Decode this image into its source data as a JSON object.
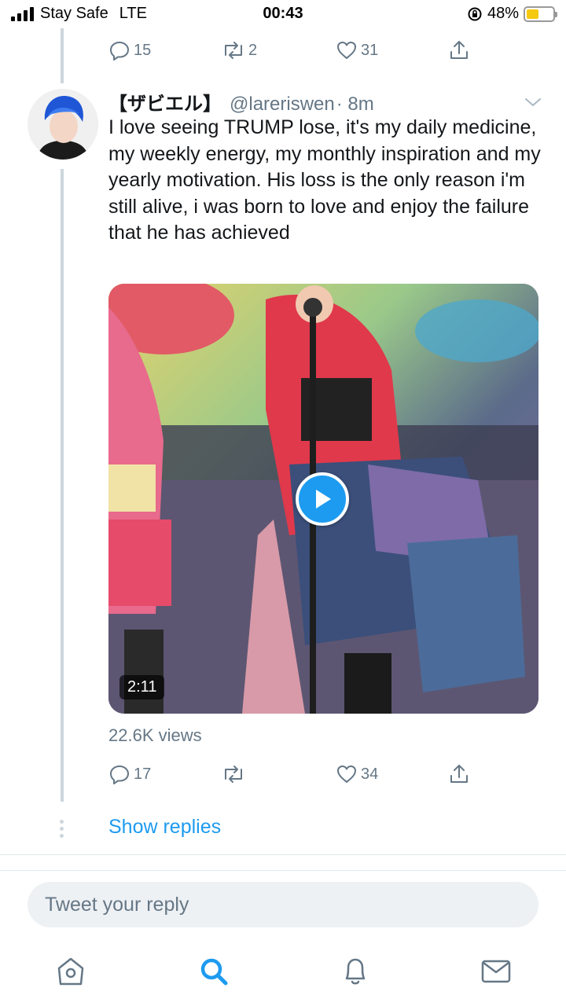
{
  "status_bar": {
    "carrier": "Stay Safe",
    "network": "LTE",
    "time": "00:43",
    "battery_percent": "48%",
    "battery_level": 0.48
  },
  "prev_tweet": {
    "replies": "15",
    "retweets": "2",
    "likes": "31"
  },
  "tweet": {
    "name": "【ザビエル】",
    "handle": "@lareriswen",
    "time": "· 8m",
    "text": "I love seeing TRUMP lose, it's my daily medicine, my weekly energy, my monthly inspiration and my yearly motivation. His loss is the only reason i'm still alive, i was born to love and enjoy the failure that he has achieved",
    "video_duration": "2:11",
    "views": "22.6K views",
    "replies": "17",
    "likes": "34"
  },
  "show_replies": "Show replies",
  "reply_box": {
    "placeholder": "Tweet your reply"
  },
  "tab_bar": {
    "tabs": [
      "home-icon",
      "search-icon",
      "notifications-icon",
      "messages-icon"
    ],
    "active": "search-icon"
  },
  "colors": {
    "accent": "#1d9bf0",
    "secondary_text": "#657786",
    "thread_line": "#ccd6dd"
  }
}
